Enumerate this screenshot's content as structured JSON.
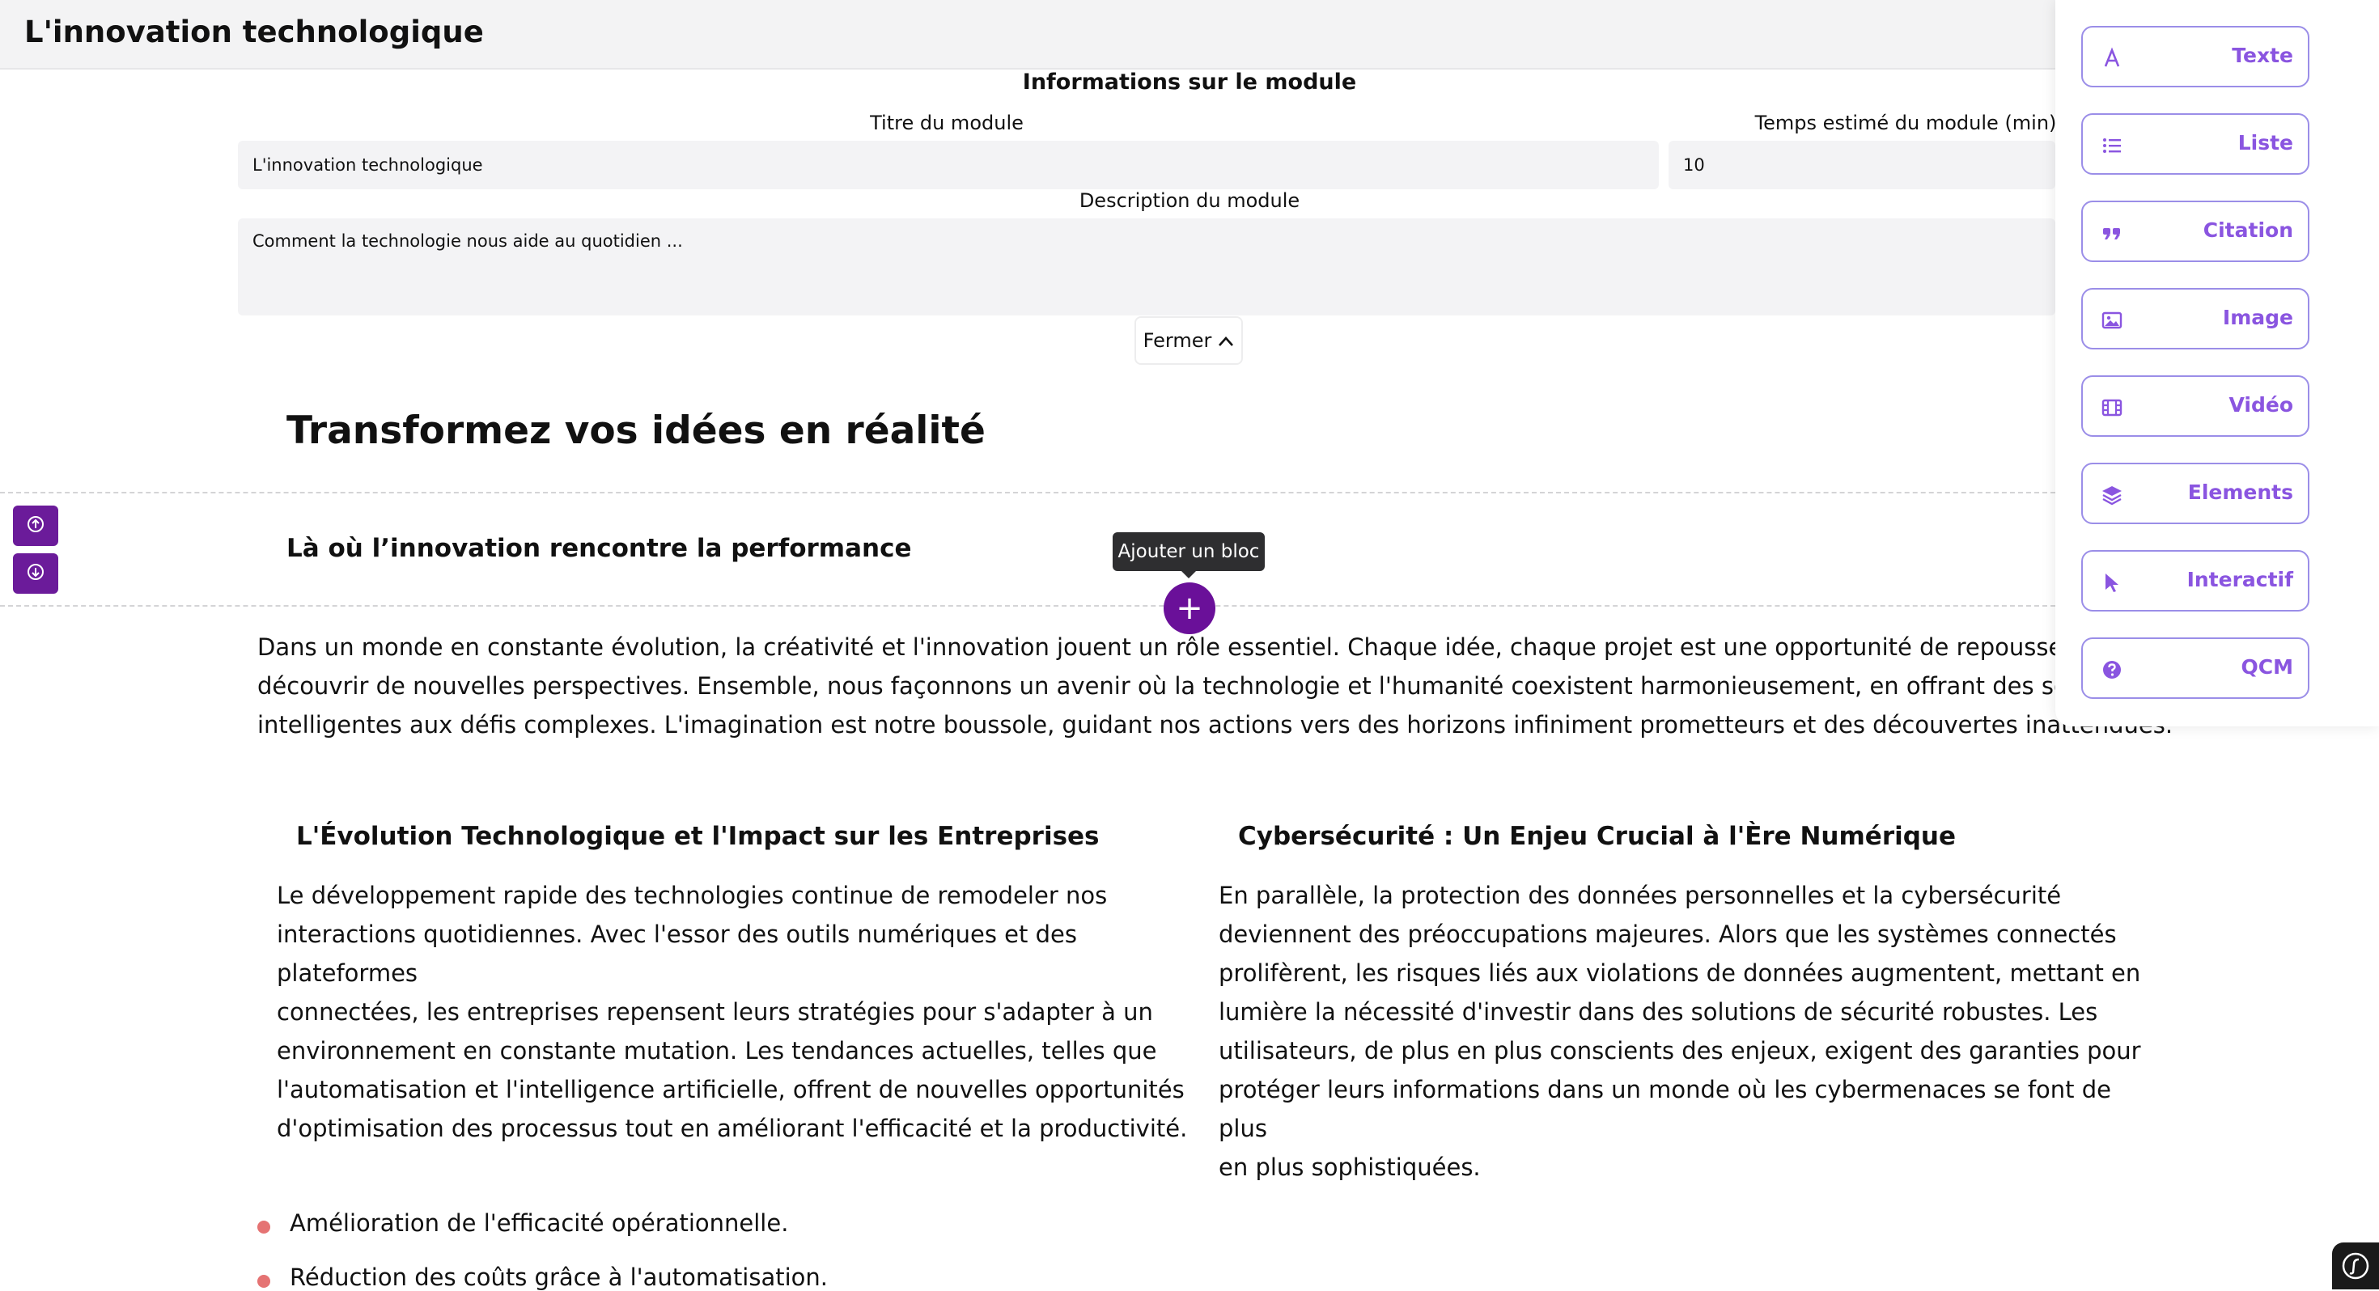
{
  "header": {
    "title": "L'innovation technologique"
  },
  "module_info": {
    "section_title": "Informations sur le module",
    "title_label": "Titre du module",
    "title_value": "L'innovation technologique",
    "time_label": "Temps estimé du module (min)",
    "time_value": "10",
    "description_label": "Description du module",
    "description_value": "Comment la technologie nous aide au quotidien ...",
    "close_label": "Fermer"
  },
  "content": {
    "heading": "Transformez vos idées en réalité",
    "subheading": "Là où l’innovation rencontre la performance",
    "tooltip": "Ajouter un bloc",
    "add_symbol": "+",
    "intro_lines": [
      "Dans un monde en constante évolution, la créativité et l'innovation jouent un rôle essentiel. Chaque idée, chaque projet est une opportunité de repousser les limites",
      "découvrir de nouvelles perspectives. Ensemble, nous façonnons un avenir où la technologie et l'humanité coexistent harmonieusement, en offrant des solutions",
      "intelligentes aux défis complexes. L'imagination est notre boussole, guidant nos actions vers des horizons infiniment prometteurs et des découvertes inattendues."
    ],
    "col_left": {
      "title": "L'Évolution Technologique et l'Impact sur les Entreprises",
      "lines": [
        "Le développement rapide des technologies continue de remodeler nos",
        "interactions quotidiennes. Avec l'essor des outils numériques et des plateformes",
        "connectées, les entreprises repensent leurs stratégies pour s'adapter à un",
        "environnement en constante mutation. Les tendances actuelles, telles que",
        "l'automatisation et l'intelligence artificielle, offrent de nouvelles opportunités",
        "d'optimisation des processus tout en améliorant l'efficacité et la productivité."
      ]
    },
    "col_right": {
      "title": "Cybersécurité : Un Enjeu Crucial à l'Ère Numérique",
      "lines": [
        "En parallèle, la protection des données personnelles et la cybersécurité",
        "deviennent des préoccupations majeures. Alors que les systèmes connectés",
        "prolifèrent, les risques liés aux violations de données augmentent, mettant en",
        "lumière la nécessité d'investir dans des solutions de sécurité robustes. Les",
        "utilisateurs, de plus en plus conscients des enjeux, exigent des garanties pour",
        "protéger leurs informations dans un monde où les cybermenaces se font de plus",
        "en plus sophistiquées."
      ]
    },
    "bullets": [
      "Amélioration de l'efficacité opérationnelle.",
      "Réduction des coûts grâce à l'automatisation."
    ]
  },
  "sidebar": {
    "tools": [
      {
        "label": "Texte",
        "icon": "text-icon"
      },
      {
        "label": "Liste",
        "icon": "list-icon"
      },
      {
        "label": "Citation",
        "icon": "quote-icon"
      },
      {
        "label": "Image",
        "icon": "image-icon"
      },
      {
        "label": "Vidéo",
        "icon": "video-icon"
      },
      {
        "label": "Elements",
        "icon": "layers-icon"
      },
      {
        "label": "Interactif",
        "icon": "cursor-icon"
      },
      {
        "label": "QCM",
        "icon": "question-icon"
      }
    ]
  },
  "colors": {
    "accent": "#6a1099",
    "tool_border": "#9b8ee8",
    "tool_text": "#8a55e0",
    "bullet": "#e57373"
  }
}
